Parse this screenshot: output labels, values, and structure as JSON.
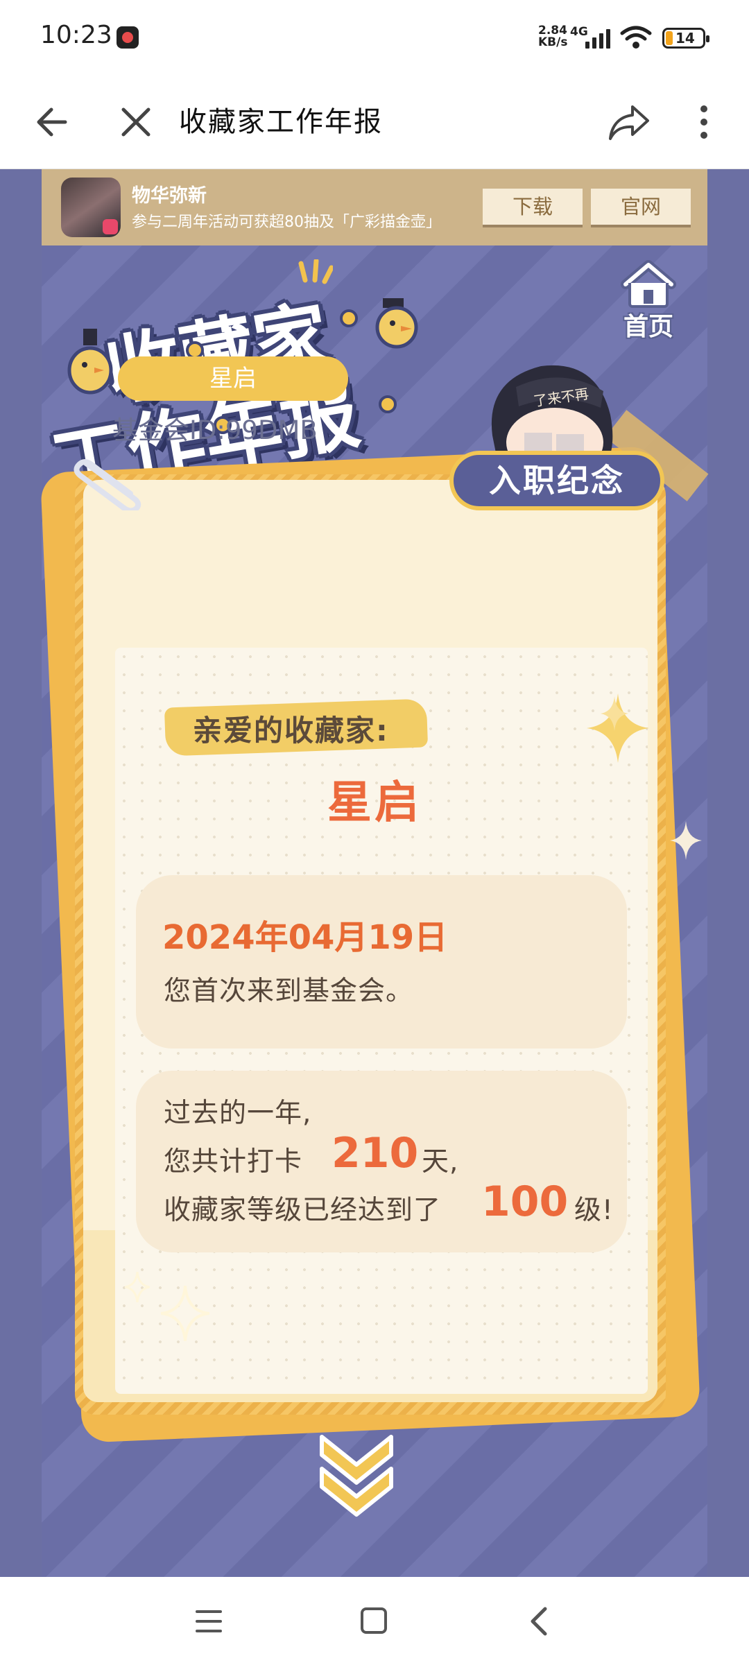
{
  "status": {
    "time": "10:23",
    "net_speed_top": "2.84",
    "net_speed_bottom": "KB/s",
    "network": "4G",
    "battery": "14"
  },
  "toolbar": {
    "title": "收藏家工作年报",
    "back_icon": "arrow-left-icon",
    "close_icon": "close-icon",
    "share_icon": "share-icon",
    "more_icon": "more-vertical-icon"
  },
  "banner": {
    "app_name": "物华弥新",
    "subtitle": "参与二周年活动可获超80抽及「广彩描金壶」",
    "download_label": "下载",
    "official_label": "官网"
  },
  "page": {
    "home_label": "首页",
    "logo_line1": "收藏家",
    "logo_line2": "工作年报",
    "nickname": "星启",
    "foundation_id": "基金会ID:99DMB",
    "badge_label": "入职纪念",
    "avatar_text": "了来不再",
    "greeting": "亲爱的收藏家:",
    "greeting_name": "星启",
    "first_date": "2024年04月19日",
    "first_visit_text": "您首次来到基金会。",
    "past_year_text": "过去的一年,",
    "checkin_prefix": "您共计打卡",
    "checkin_days": "210",
    "checkin_suffix": "天,",
    "level_prefix": "收藏家等级已经达到了",
    "level_value": "100",
    "level_suffix": "级!"
  },
  "colors": {
    "accent_orange": "#ec6a3c",
    "card_yellow": "#f2b94e",
    "bg_indigo": "#6e73ad"
  }
}
